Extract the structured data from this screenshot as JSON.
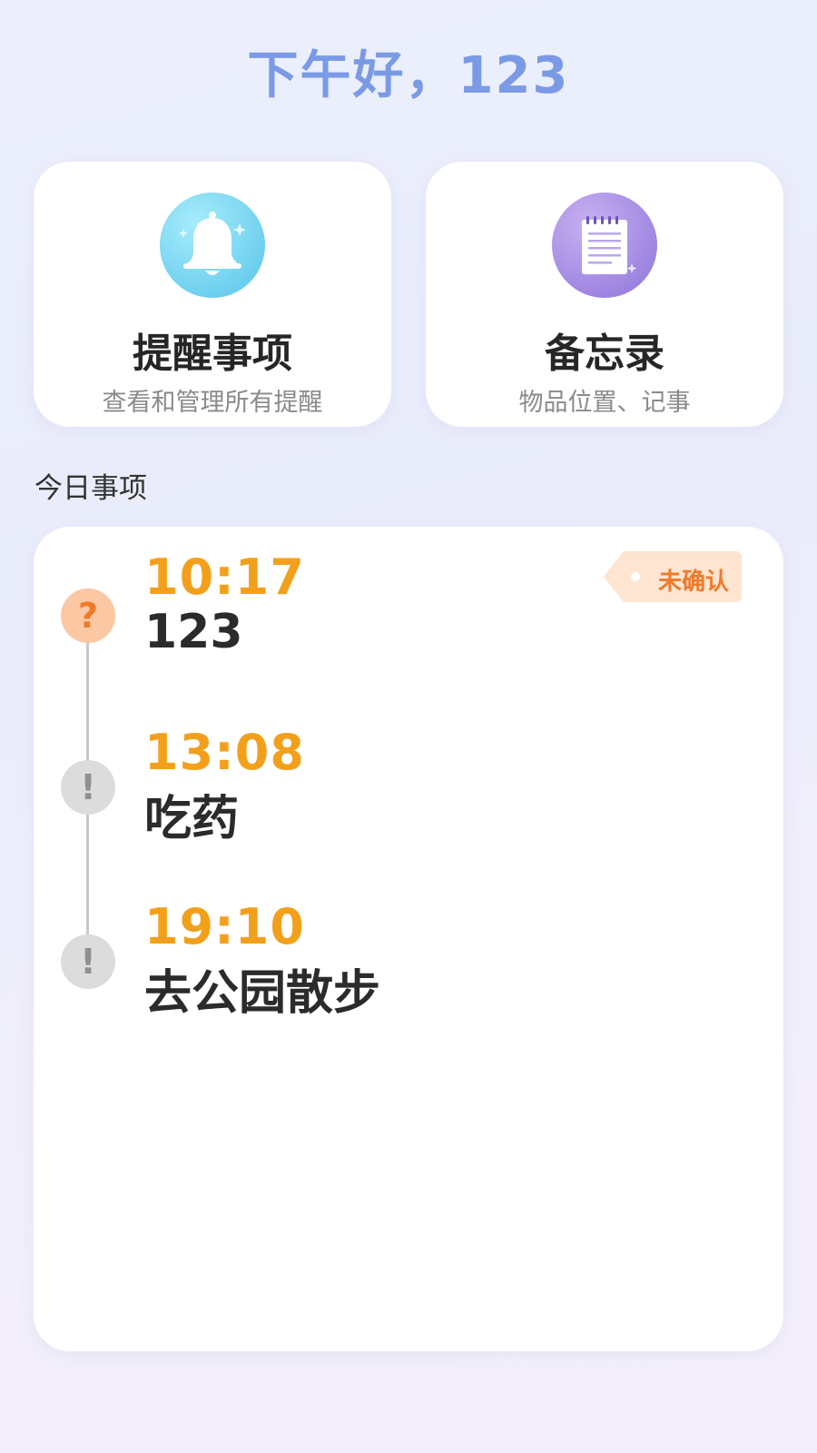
{
  "greeting": "下午好，123",
  "cards": {
    "reminders": {
      "title": "提醒事项",
      "subtitle": "查看和管理所有提醒",
      "icon": "bell-icon"
    },
    "memo": {
      "title": "备忘录",
      "subtitle": "物品位置、记事",
      "icon": "notepad-icon"
    }
  },
  "today": {
    "label": "今日事项",
    "events": [
      {
        "time": "10:17",
        "title": "123",
        "status_icon": "?",
        "status": "unconfirmed",
        "badge": "未确认"
      },
      {
        "time": "13:08",
        "title": "吃药",
        "status_icon": "!",
        "status": "pending"
      },
      {
        "time": "19:10",
        "title": "去公园散步",
        "status_icon": "!",
        "status": "pending"
      }
    ]
  },
  "colors": {
    "greeting": "#7b9ae6",
    "time": "#f2a01c",
    "unconfirmed_accent": "#f07a2b",
    "bell_icon_bg": "#6fd0ef",
    "notepad_icon_bg": "#9f86e2"
  }
}
